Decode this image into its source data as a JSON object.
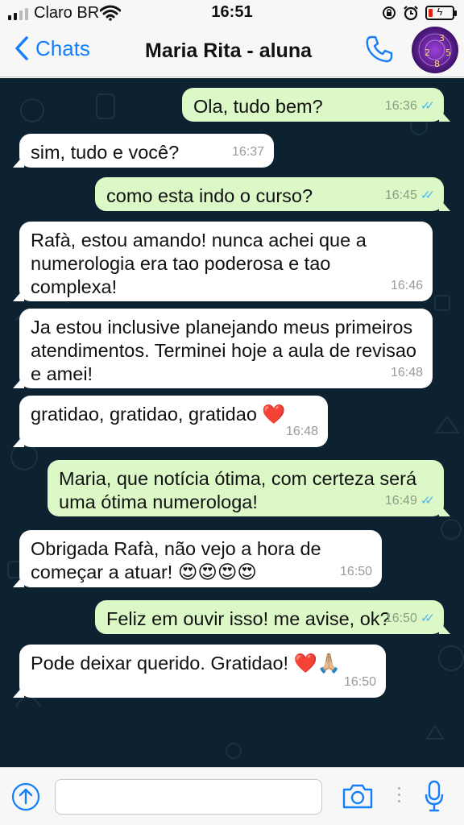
{
  "status_bar": {
    "carrier": "Claro BR",
    "time": "16:51",
    "battery_level": 0.18
  },
  "header": {
    "back_label": "Chats",
    "contact_name": "Maria Rita - aluna",
    "avatar_digits": [
      "3",
      "2",
      "8",
      "5"
    ]
  },
  "messages": [
    {
      "direction": "out",
      "text": "Ola, tudo bem?",
      "time": "16:36",
      "read": true
    },
    {
      "direction": "in",
      "text": "sim, tudo e você?",
      "time": "16:37"
    },
    {
      "direction": "out",
      "text": "como esta indo o curso?",
      "time": "16:45",
      "read": true
    },
    {
      "direction": "in",
      "text": "Rafà, estou amando! nunca achei que a numerologia era tao poderosa e tao complexa!",
      "time": "16:46"
    },
    {
      "direction": "in",
      "text": "Ja estou inclusive planejando meus primeiros atendimentos. Terminei hoje a aula de revisao e amei!",
      "time": "16:48"
    },
    {
      "direction": "in",
      "text": "gratidao, gratidao, gratidao",
      "emoji": "❤️",
      "time": "16:48"
    },
    {
      "direction": "out",
      "text": "Maria, que notícia ótima, com certeza será uma ótima numerologa!",
      "time": "16:49",
      "read": true
    },
    {
      "direction": "in",
      "text": "Obrigada Rafà, não vejo a hora de começar a atuar!",
      "emoji": "😍😍😍😍",
      "time": "16:50"
    },
    {
      "direction": "out",
      "text": "Feliz em ouvir isso! me avise, ok?",
      "time": "16:50",
      "read": true
    },
    {
      "direction": "in",
      "text": "Pode deixar querido. Gratidao!",
      "emoji": "❤️🙏🏼",
      "time": "16:50"
    }
  ],
  "composer": {
    "placeholder": ""
  },
  "icons": {
    "back": "chevron-left-icon",
    "call": "phone-icon",
    "attach": "plus-circle-icon",
    "camera": "camera-icon",
    "mic": "microphone-icon",
    "read_receipt": "double-check-icon"
  },
  "colors": {
    "accent": "#147efb",
    "chat_background": "#0c2230",
    "outgoing_bubble": "#dcf8c6",
    "incoming_bubble": "#ffffff",
    "read_ticks": "#4fb6ec",
    "battery_low": "#e2231a"
  }
}
